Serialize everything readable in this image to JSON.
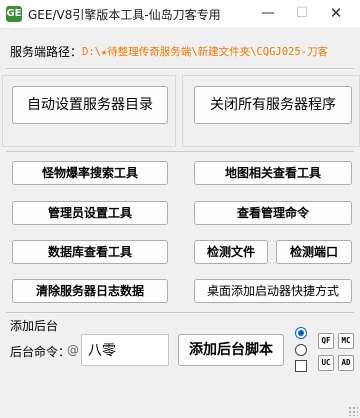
{
  "window": {
    "title": "GEE/V8引擎版本工具-仙岛刀客专用",
    "app_icon": "GE",
    "minimize_glyph": "—",
    "maximize_glyph": "☐",
    "close_glyph": "✕"
  },
  "server_path": {
    "label": "服务端路径：",
    "value": "D:\\★待整理传奇服务端\\新建文件夹\\CQGJ025-刀客"
  },
  "main_buttons": {
    "auto_set_dir": "自动设置服务器目录",
    "close_all": "关闭所有服务器程序"
  },
  "tool_buttons": {
    "monster_drop": "怪物爆率搜索工具",
    "map_tool": "地图相关查看工具",
    "admin_setup": "管理员设置工具",
    "admin_cmd": "查看管理命令",
    "db_tool": "数据库查看工具",
    "check_file": "检测文件",
    "check_port": "检测端口",
    "clear_logs": "清除服务器日志数据",
    "desktop_shortcut": "桌面添加启动器快捷方式"
  },
  "backend": {
    "section_label": "添加后台",
    "cmd_label": "后台命令：",
    "at_symbol": "@",
    "cmd_value": "八零",
    "add_button": "添加后台脚本",
    "options": {
      "radio1_checked": true,
      "radio2_checked": false,
      "checkbox_checked": false
    },
    "mini_buttons": [
      "QF",
      "MC",
      "UC",
      "AD"
    ]
  },
  "colors": {
    "path_value": "#e87b00",
    "radio_accent": "#0067c0",
    "app_icon": "#3b8f34"
  }
}
